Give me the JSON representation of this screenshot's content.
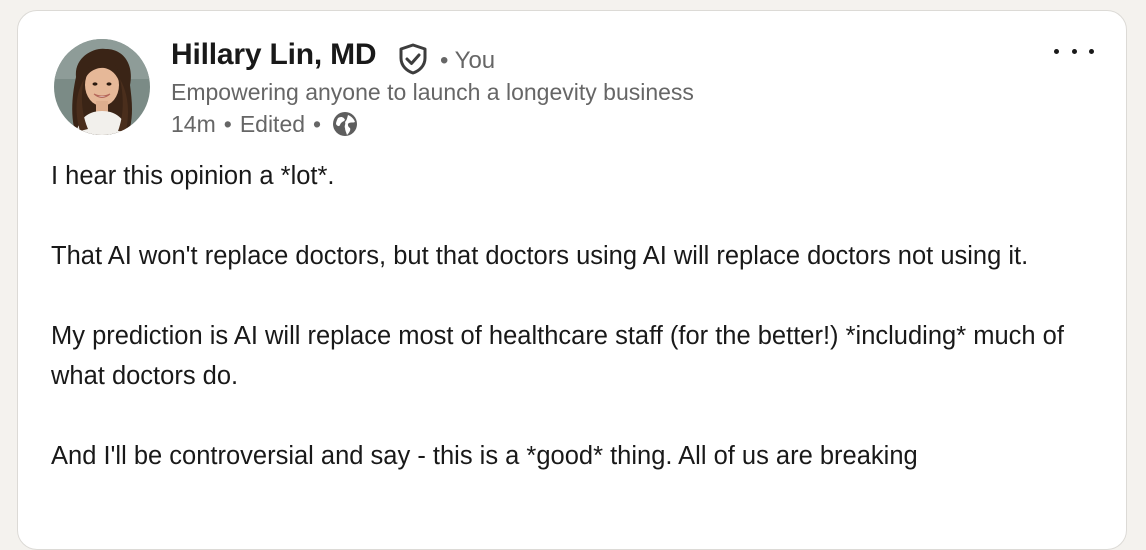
{
  "post": {
    "author": {
      "name": "Hillary Lin, MD",
      "degree": "• You",
      "headline": "Empowering anyone to launch a longevity business",
      "time": "14m",
      "edited": "Edited",
      "verified_icon": "shield-check-icon",
      "visibility_icon": "globe-icon"
    },
    "more_icon": "ellipsis-icon",
    "body": [
      "I hear this opinion a *lot*.",
      "That AI won't replace doctors, but that doctors using AI will replace doctors not using it.",
      "My prediction is AI will replace most of healthcare staff (for the better!) *including* much of what doctors do.",
      "And I'll be controversial and say - this is a *good* thing. All of us are breaking"
    ]
  },
  "colors": {
    "page_bg": "#f4f2ee",
    "card_bg": "#ffffff",
    "primary_text": "#191919",
    "secondary_text": "#666666"
  }
}
